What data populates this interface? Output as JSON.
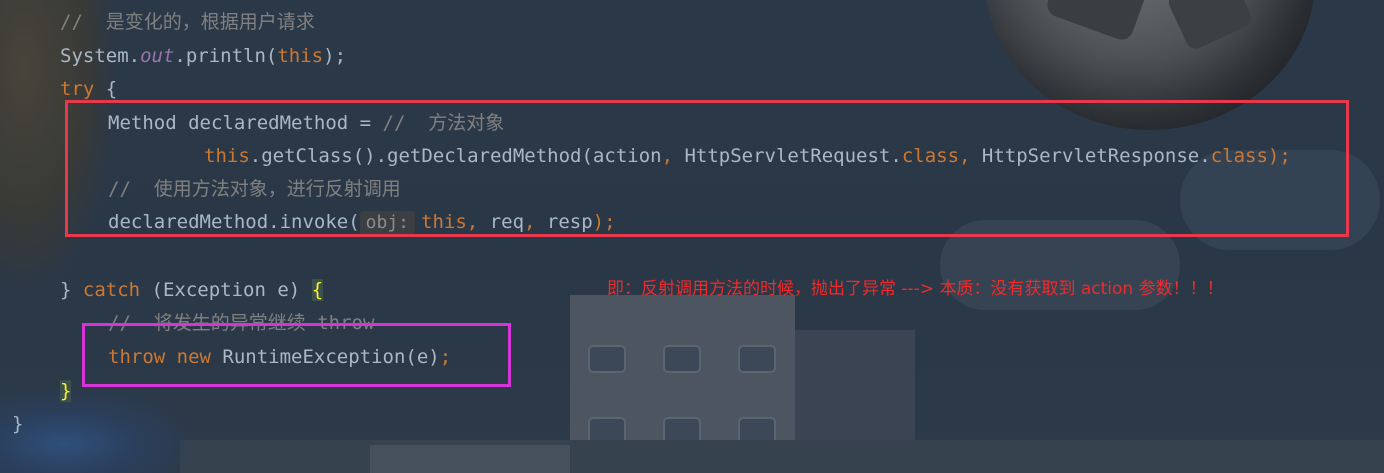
{
  "editor": {
    "lines": {
      "comment_variable": "//  是变化的，根据用户请求",
      "println_obj": "System.",
      "println_field": "out",
      "println_call": ".println(",
      "println_this": "this",
      "println_end": ");",
      "try_kw": "try",
      "try_brace": " {",
      "method_decl": "Method declaredMethod = ",
      "method_comment": "//  方法对象",
      "getclass_this": "this",
      "getclass_call": ".getClass().getDeclaredMethod(action",
      "getclass_comma1": ",",
      "getclass_req": " HttpServletRequest.",
      "getclass_class1": "class",
      "getclass_comma2": ",",
      "getclass_resp": " HttpServletResponse.",
      "getclass_class2": "class",
      "getclass_end": ");",
      "reflect_comment": "//  使用方法对象，进行反射调用",
      "invoke_call": "declaredMethod.invoke(",
      "invoke_hint": "obj:",
      "invoke_this": "this",
      "invoke_comma1": ",",
      "invoke_req": " req",
      "invoke_comma2": ",",
      "invoke_resp": " resp",
      "invoke_end": ");",
      "catch_close": "} ",
      "catch_kw": "catch",
      "catch_params": " (Exception e) ",
      "catch_brace": "{",
      "throw_comment": "//  将发生的异常继续 throw",
      "throw_kw": "throw",
      "new_kw": " new",
      "throw_rest": " RuntimeException(e)",
      "throw_end": ";",
      "close_inner": "}",
      "close_outer": "}"
    }
  },
  "annotation": {
    "note": "即：反射调用方法的时候，抛出了异常 ---> 本质：没有获取到 action 参数！！！"
  },
  "colors": {
    "keyword": "#cc7832",
    "comment": "#808080",
    "text": "#a9b7c6",
    "field": "#9876aa",
    "red_box": "#e8394c",
    "magenta_box": "#d633d8",
    "note": "#ef2b2b"
  }
}
